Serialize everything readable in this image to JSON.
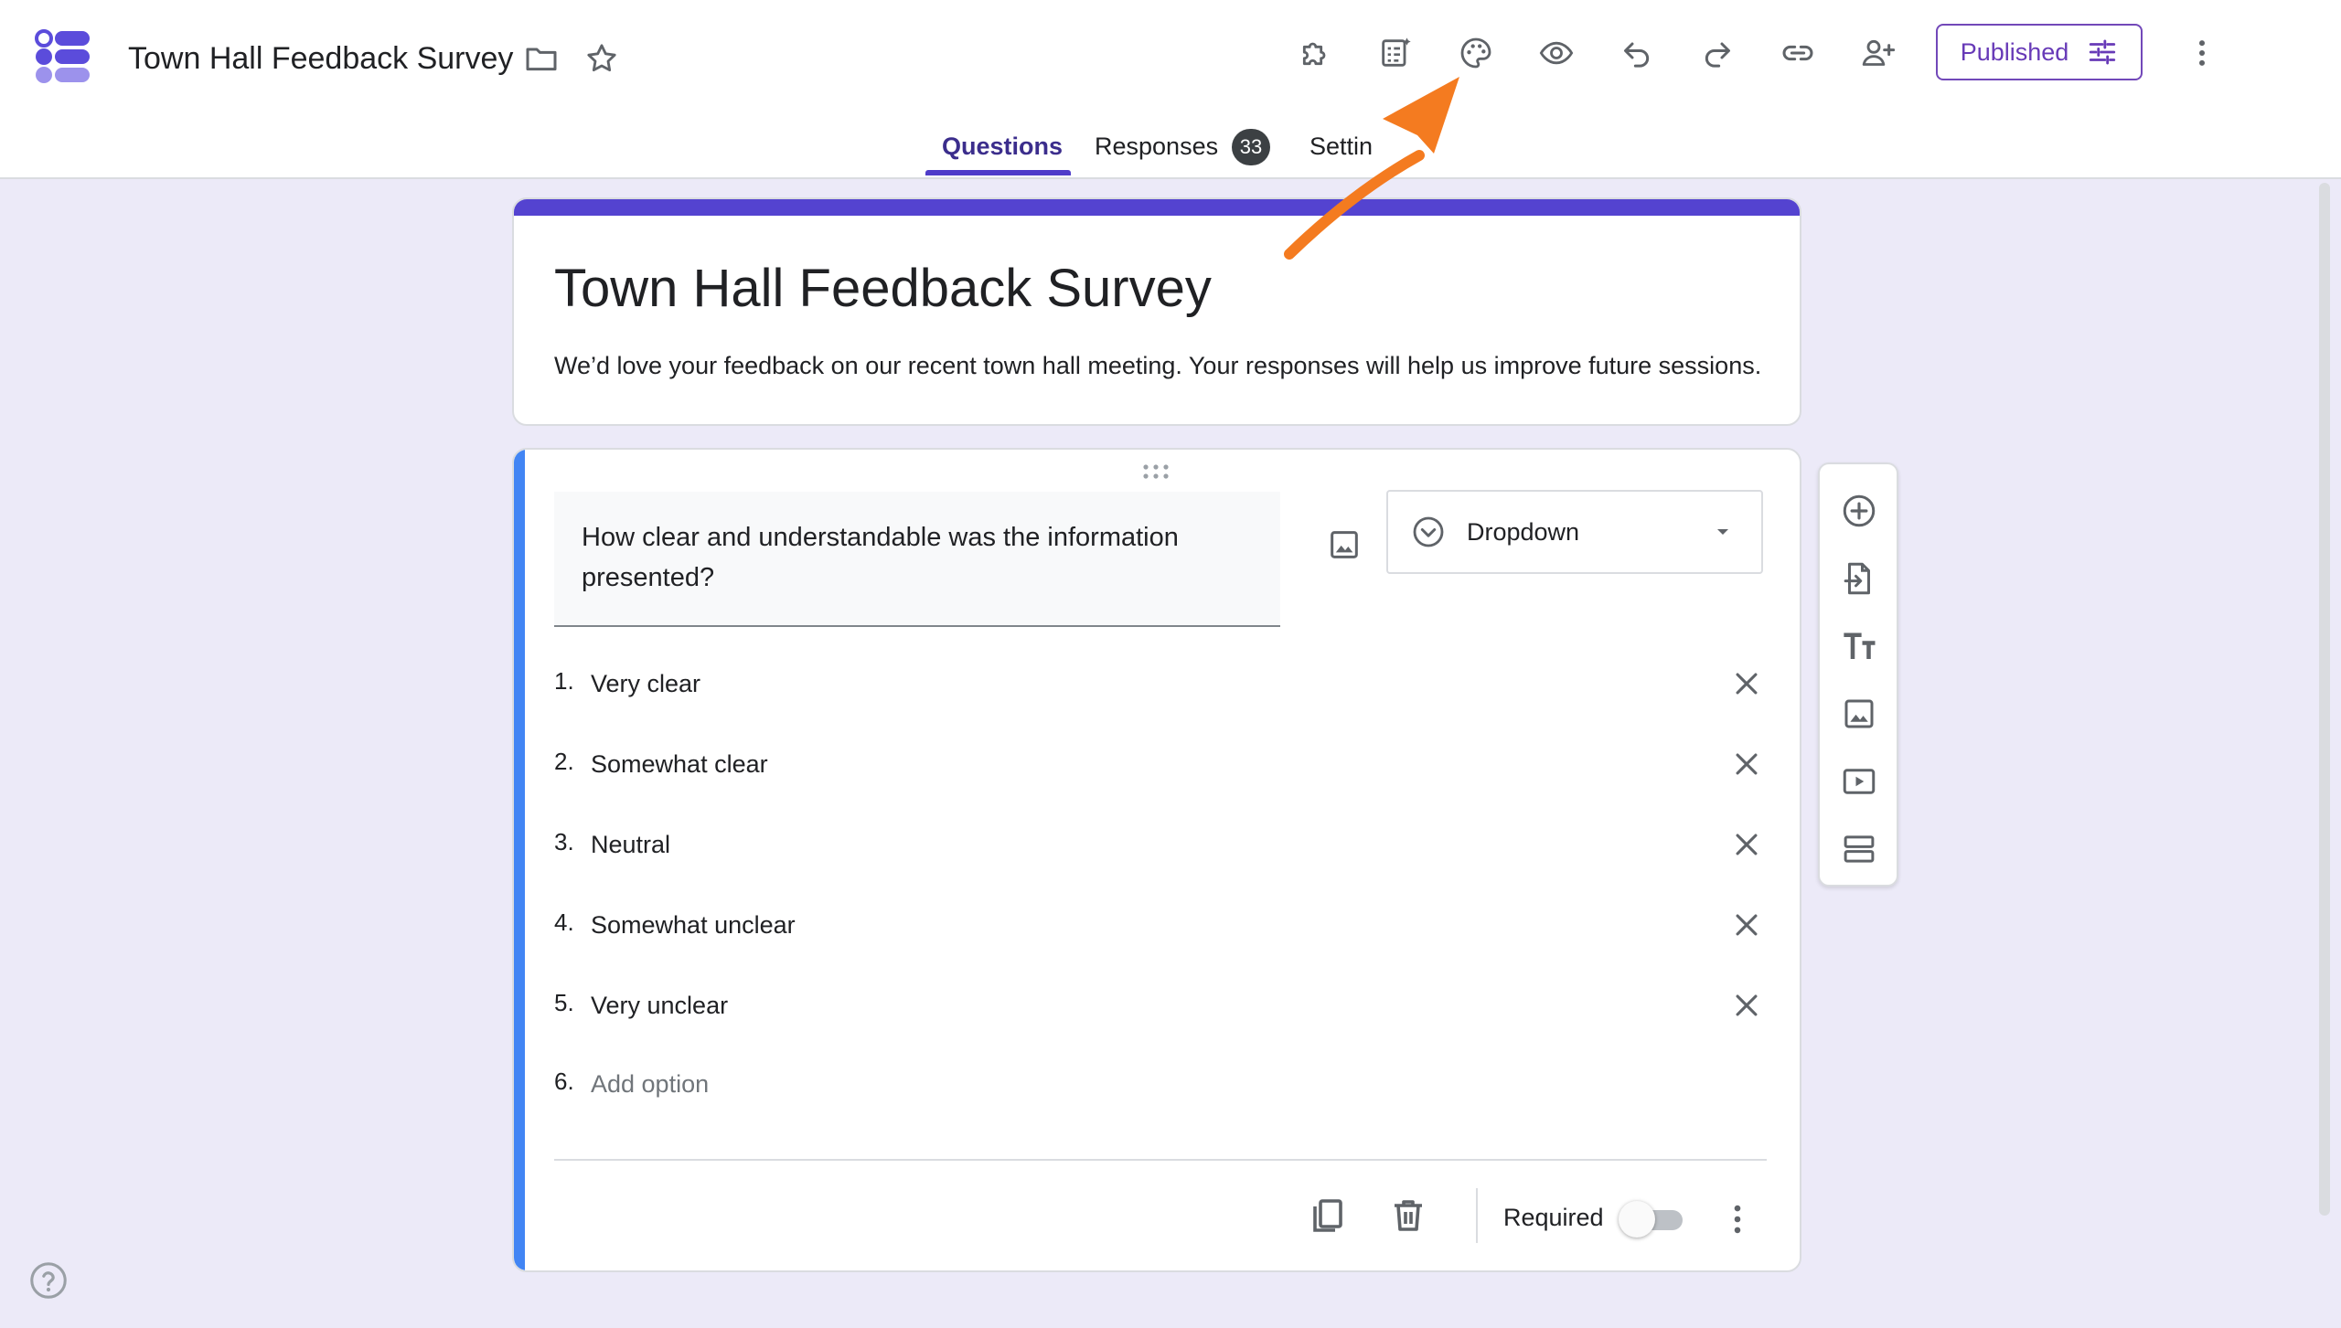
{
  "header": {
    "doc_title": "Town Hall Feedback Survey",
    "publish_label": "Published",
    "tabs": [
      {
        "label": "Questions"
      },
      {
        "label": "Responses",
        "badge": "33"
      },
      {
        "label": "Settin"
      }
    ],
    "toolbar_icons": [
      "addons-icon",
      "ai-checklist-icon",
      "palette-icon",
      "preview-eye-icon",
      "undo-icon",
      "redo-icon",
      "link-icon",
      "add-collaborator-icon",
      "more-vert-icon"
    ]
  },
  "form": {
    "title": "Town Hall Feedback Survey",
    "description": "We’d love your feedback on our recent town hall meeting. Your responses will help us improve future sessions."
  },
  "question": {
    "text": "How clear and understandable was the information presented?",
    "type": "Dropdown",
    "options": [
      {
        "num": "1.",
        "label": "Very clear"
      },
      {
        "num": "2.",
        "label": "Somewhat clear"
      },
      {
        "num": "3.",
        "label": "Neutral"
      },
      {
        "num": "4.",
        "label": "Somewhat unclear"
      },
      {
        "num": "5.",
        "label": "Very unclear"
      }
    ],
    "add_option": {
      "num": "6.",
      "label": "Add option"
    },
    "required_label": "Required",
    "required": false
  },
  "side_toolbar": [
    "add-question-icon",
    "import-questions-icon",
    "add-title-icon",
    "add-image-icon",
    "add-video-icon",
    "add-section-icon"
  ],
  "colors": {
    "accent": "#673ab7",
    "header_bar": "#5443d0",
    "question_bar": "#4285f4",
    "background": "#eceaf8",
    "annotation_arrow": "#f47b20"
  }
}
